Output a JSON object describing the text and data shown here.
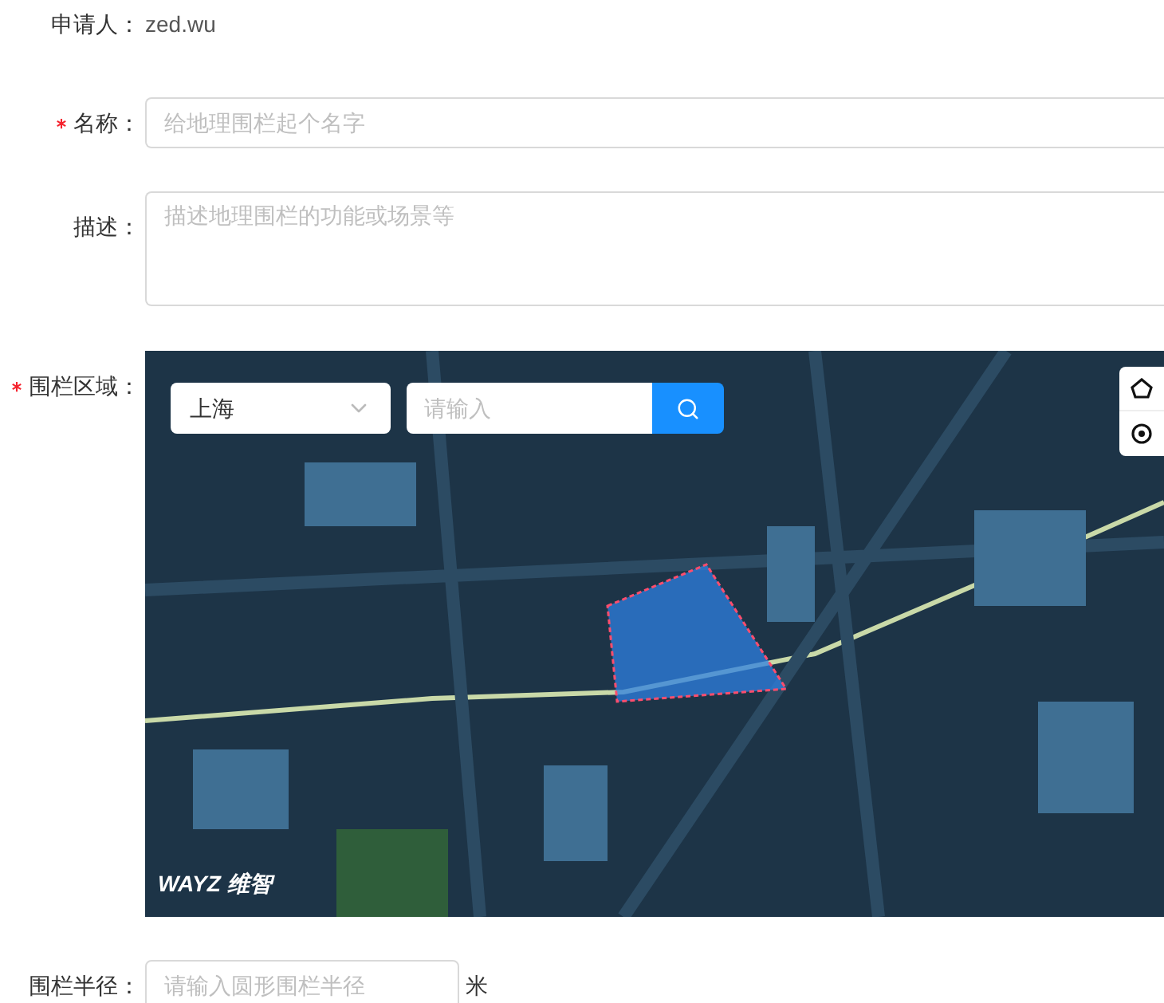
{
  "applicant": {
    "label": "申请人：",
    "value": "zed.wu"
  },
  "name_field": {
    "label": "名称：",
    "required": true,
    "placeholder": "给地理围栏起个名字"
  },
  "description_field": {
    "label": "描述：",
    "required": false,
    "placeholder": "描述地理围栏的功能或场景等"
  },
  "area": {
    "label": "围栏区域：",
    "required": true,
    "city": "上海",
    "search_placeholder": "请输入",
    "logo": "WAYZ 维智"
  },
  "radius_field": {
    "label": "围栏半径：",
    "required": false,
    "placeholder": "请输入圆形围栏半径",
    "unit": "米"
  }
}
